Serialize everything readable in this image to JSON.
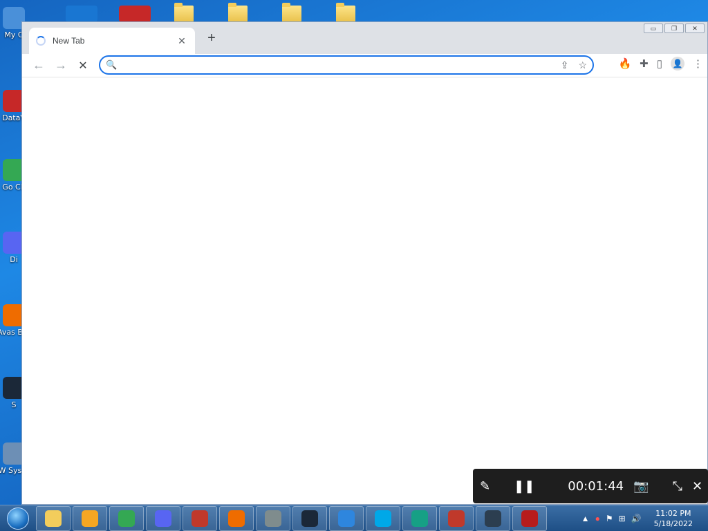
{
  "desktop": {
    "icons": [
      {
        "label": "My C",
        "color": "#4a90d9"
      },
      {
        "label": "DataV",
        "color": "#c62828"
      },
      {
        "label": "Go Ch",
        "color": "#34a853"
      },
      {
        "label": "Di",
        "color": "#5865f2"
      },
      {
        "label": "Avas Bro",
        "color": "#ef6c00"
      },
      {
        "label": "S",
        "color": "#1b2838"
      },
      {
        "label": "W Syste",
        "color": "#6d8fb5"
      }
    ]
  },
  "browser": {
    "tab": {
      "title": "New Tab",
      "close": "✕"
    },
    "new_tab": "+",
    "window_controls": [
      "▭",
      "❐",
      "✕"
    ],
    "nav": {
      "back": "←",
      "forward": "→",
      "stop": "✕"
    },
    "omnibox": {
      "value": "",
      "placeholder": ""
    },
    "omnibox_icons": {
      "search": "🔍",
      "share": "⇪",
      "star": "☆"
    },
    "toolbar_icons": {
      "extension_fire": "🔥",
      "extensions": "✚",
      "sidepanel": "▯",
      "profile": "👤",
      "menu": "⋮"
    }
  },
  "recorder": {
    "pen": "✎",
    "pause": "❚❚",
    "timer": "00:01:44",
    "camera": "📷",
    "collapse": "⤡",
    "close": "✕"
  },
  "taskbar": {
    "apps": [
      {
        "name": "explorer",
        "color": "#f3cd5c"
      },
      {
        "name": "media",
        "color": "#f5a623"
      },
      {
        "name": "chrome",
        "color": "#34a853"
      },
      {
        "name": "discord",
        "color": "#5865f2"
      },
      {
        "name": "java",
        "color": "#c0392b"
      },
      {
        "name": "avast",
        "color": "#ef6c00"
      },
      {
        "name": "tool",
        "color": "#7f8c8d"
      },
      {
        "name": "steam",
        "color": "#1b2838"
      },
      {
        "name": "shield",
        "color": "#2e86de"
      },
      {
        "name": "wave",
        "color": "#00a8e8"
      },
      {
        "name": "arrow",
        "color": "#16a085"
      },
      {
        "name": "gear-red",
        "color": "#c0392b"
      },
      {
        "name": "monitor",
        "color": "#2c3e50"
      },
      {
        "name": "filezilla",
        "color": "#b71c1c"
      }
    ],
    "clock": {
      "time": "11:02 PM",
      "date": "5/18/2022"
    }
  }
}
